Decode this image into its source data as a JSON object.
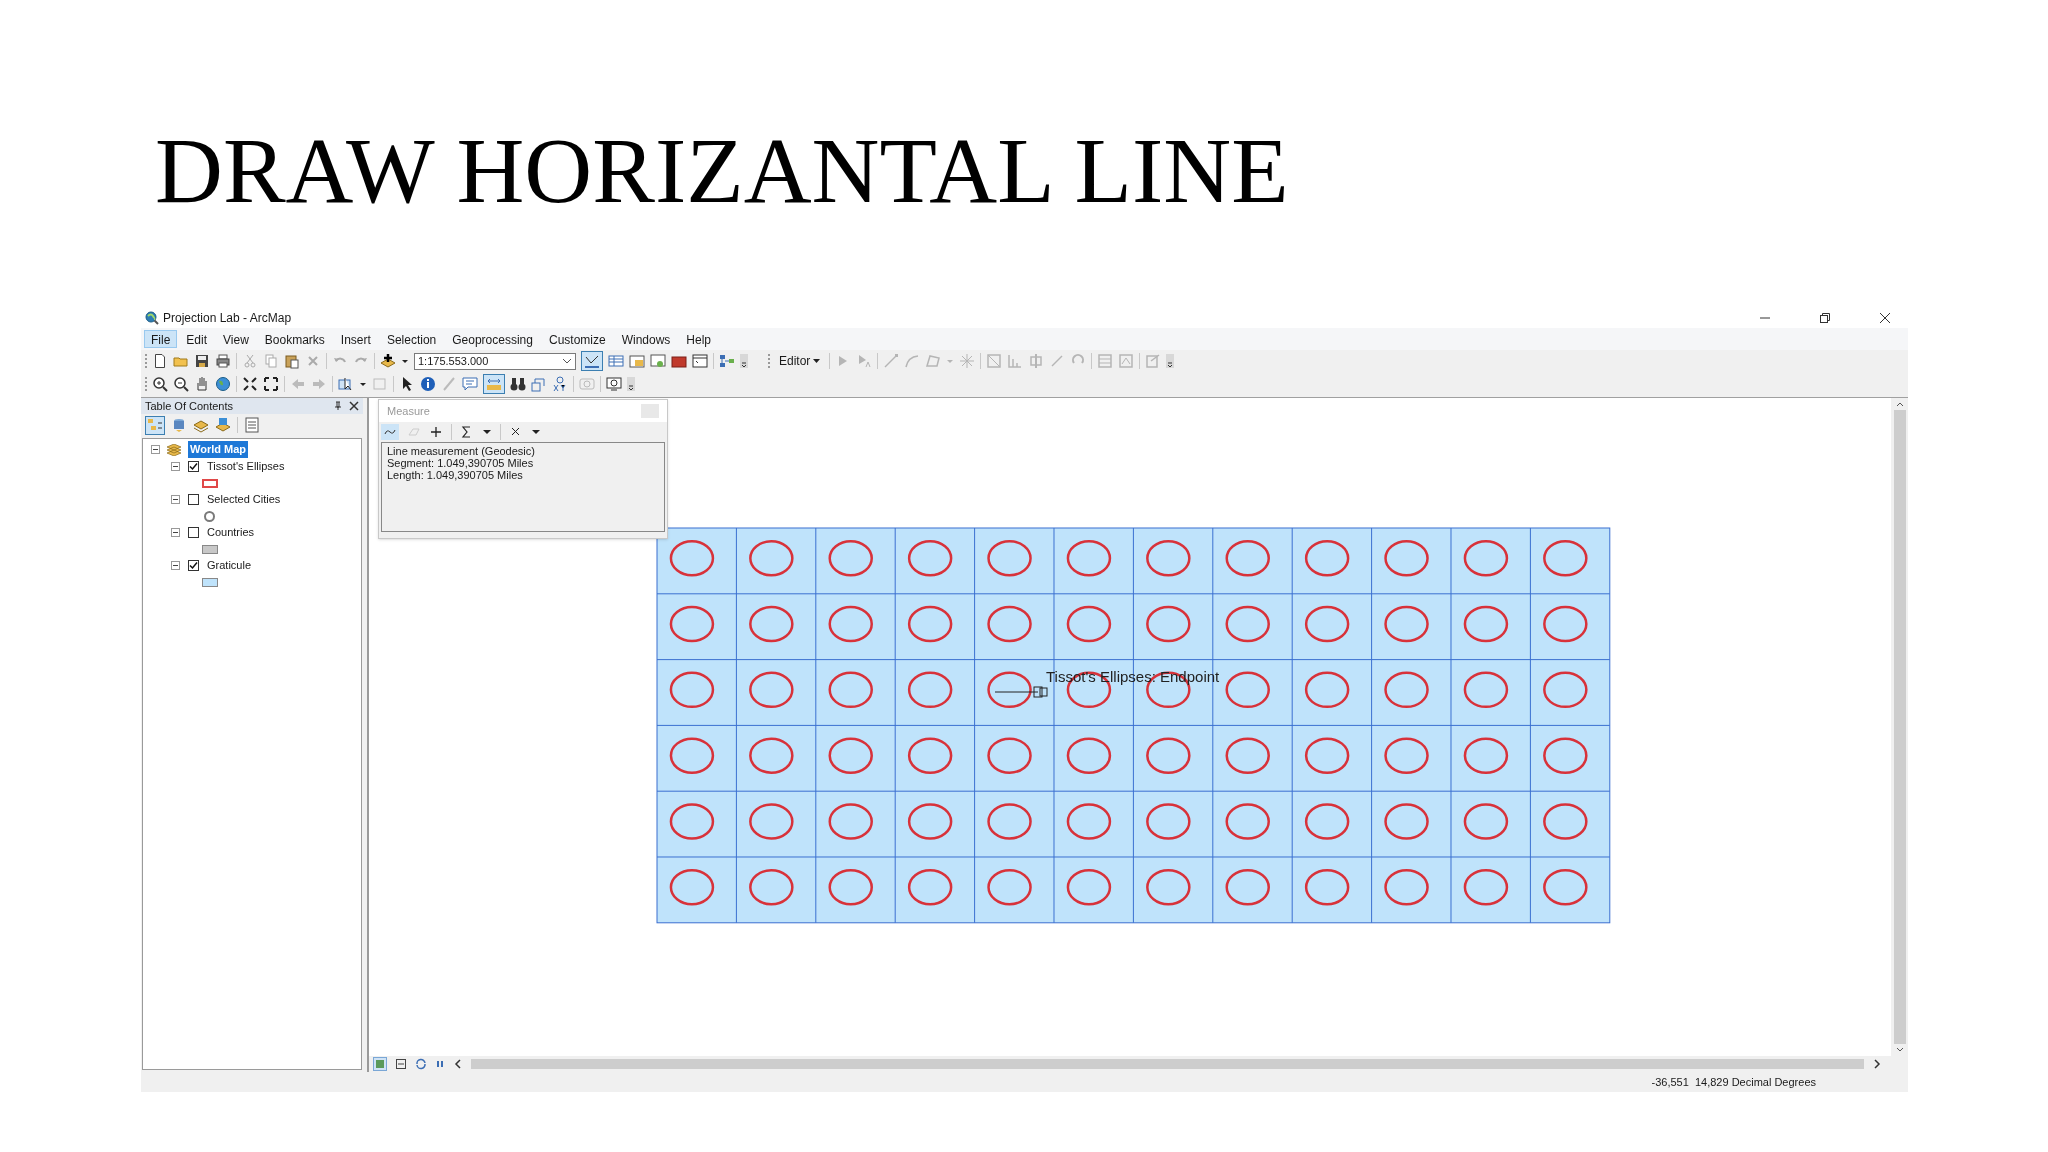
{
  "slide_title": "DRAW HORIZANTAL LINE",
  "window": {
    "title": "Projection Lab - ArcMap"
  },
  "menus": [
    {
      "label": "File",
      "selected": true
    },
    {
      "label": "Edit",
      "selected": false
    },
    {
      "label": "View",
      "selected": false
    },
    {
      "label": "Bookmarks",
      "selected": false
    },
    {
      "label": "Insert",
      "selected": false
    },
    {
      "label": "Selection",
      "selected": false
    },
    {
      "label": "Geoprocessing",
      "selected": false
    },
    {
      "label": "Customize",
      "selected": false
    },
    {
      "label": "Windows",
      "selected": false
    },
    {
      "label": "Help",
      "selected": false
    }
  ],
  "scale_field": {
    "value": "1:175.553.000"
  },
  "editor_menu": {
    "label": "Editor"
  },
  "table_of_contents": {
    "title": "Table Of Contents",
    "map": {
      "label": "World Map",
      "selected": true
    },
    "layers": [
      {
        "label": "Tissot's Ellipses",
        "checked": true,
        "kind": "outline_rect",
        "color": "#e04848"
      },
      {
        "label": "Selected Cities",
        "checked": false,
        "kind": "ring",
        "color": "#7a7a7a"
      },
      {
        "label": "Countries",
        "checked": false,
        "kind": "fill_rect",
        "color": "#c8c8c8"
      },
      {
        "label": "Graticule",
        "checked": true,
        "kind": "fill_rect",
        "color": "#bfe3fb"
      }
    ]
  },
  "measure_window": {
    "title": "Measure",
    "lines": [
      "Line measurement (Geodesic)",
      "Segment: 1.049,390705 Miles",
      "Length: 1.049,390705 Miles"
    ]
  },
  "map": {
    "snap_label": "Tissot's Ellipses: Endpoint"
  },
  "status_bar": {
    "coordinates": "-36,551  14,829 Decimal Degrees"
  }
}
